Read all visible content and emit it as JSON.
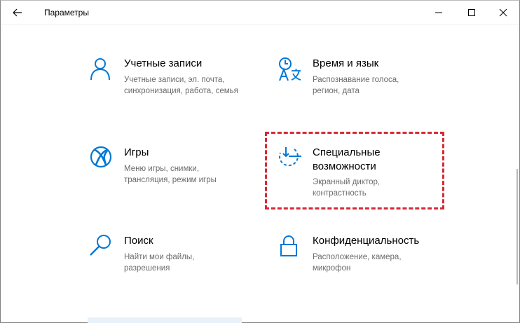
{
  "window": {
    "title": "Параметры"
  },
  "colors": {
    "accent": "#0078d7",
    "highlight": "#d42a36"
  },
  "tiles": [
    {
      "name": "accounts",
      "title": "Учетные записи",
      "desc": [
        "Учетные записи, эл. почта,",
        "синхронизация, работа, семья"
      ],
      "icon": "person-icon"
    },
    {
      "name": "time-language",
      "title": "Время и язык",
      "desc": [
        "Распознавание голоса,",
        "регион, дата"
      ],
      "icon": "time-language-icon"
    },
    {
      "name": "gaming",
      "title": "Игры",
      "desc": [
        "Меню игры, снимки,",
        "трансляция, режим игры"
      ],
      "icon": "xbox-icon"
    },
    {
      "name": "ease-of-access",
      "title": [
        "Специальные",
        "возможности"
      ],
      "desc": [
        "Экранный диктор,",
        "контрастность"
      ],
      "icon": "ease-of-access-icon"
    },
    {
      "name": "search",
      "title": "Поиск",
      "desc": [
        "Найти мои файлы,",
        "разрешения"
      ],
      "icon": "search-icon"
    },
    {
      "name": "privacy",
      "title": "Конфиденциальность",
      "desc": [
        "Расположение, камера,",
        "микрофон"
      ],
      "icon": "lock-icon"
    }
  ]
}
